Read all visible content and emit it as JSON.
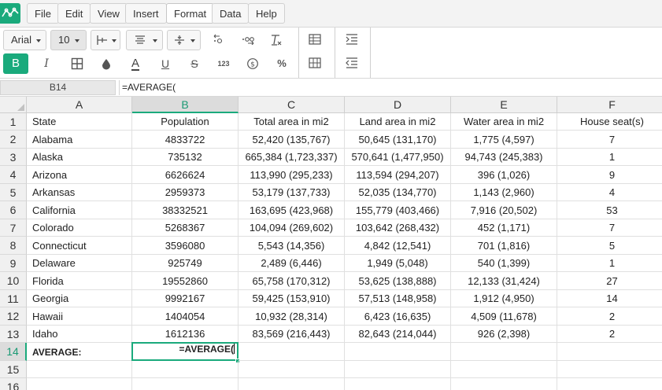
{
  "menu": {
    "items": [
      {
        "id": "file",
        "label": "File"
      },
      {
        "id": "edit",
        "label": "Edit"
      },
      {
        "id": "view",
        "label": "View"
      },
      {
        "id": "insert",
        "label": "Insert"
      },
      {
        "id": "format",
        "label": "Format"
      },
      {
        "id": "data",
        "label": "Data"
      },
      {
        "id": "help",
        "label": "Help"
      }
    ],
    "active": "Format"
  },
  "toolbar": {
    "font_family": "Arial",
    "font_size": "10",
    "number_format_label": "123",
    "accent_color": "#1aaa7c"
  },
  "formula_bar": {
    "cell_ref": "B14",
    "formula": "=AVERAGE("
  },
  "grid": {
    "columns": [
      "A",
      "B",
      "C",
      "D",
      "E",
      "F"
    ],
    "selected_column": "B",
    "selected_row": "14",
    "rows": [
      {
        "num": "1",
        "cells": [
          "State",
          "Population",
          "Total area in mi2",
          "Land area in mi2",
          "Water area in mi2",
          "House seat(s)"
        ]
      },
      {
        "num": "2",
        "cells": [
          "Alabama",
          "4833722",
          "52,420 (135,767)",
          "50,645 (131,170)",
          "1,775 (4,597)",
          "7"
        ]
      },
      {
        "num": "3",
        "cells": [
          "Alaska",
          "735132",
          "665,384 (1,723,337)",
          "570,641 (1,477,950)",
          "94,743 (245,383)",
          "1"
        ]
      },
      {
        "num": "4",
        "cells": [
          "Arizona",
          "6626624",
          "113,990 (295,233)",
          "113,594 (294,207)",
          "396 (1,026)",
          "9"
        ]
      },
      {
        "num": "5",
        "cells": [
          "Arkansas",
          "2959373",
          "53,179 (137,733)",
          "52,035 (134,770)",
          "1,143 (2,960)",
          "4"
        ]
      },
      {
        "num": "6",
        "cells": [
          "California",
          "38332521",
          "163,695 (423,968)",
          "155,779 (403,466)",
          "7,916 (20,502)",
          "53"
        ]
      },
      {
        "num": "7",
        "cells": [
          "Colorado",
          "5268367",
          "104,094 (269,602)",
          "103,642 (268,432)",
          "452 (1,171)",
          "7"
        ]
      },
      {
        "num": "8",
        "cells": [
          "Connecticut",
          "3596080",
          "5,543 (14,356)",
          "4,842 (12,541)",
          "701 (1,816)",
          "5"
        ]
      },
      {
        "num": "9",
        "cells": [
          "Delaware",
          "925749",
          "2,489 (6,446)",
          "1,949 (5,048)",
          "540 (1,399)",
          "1"
        ]
      },
      {
        "num": "10",
        "cells": [
          "Florida",
          "19552860",
          "65,758 (170,312)",
          "53,625 (138,888)",
          "12,133 (31,424)",
          "27"
        ]
      },
      {
        "num": "11",
        "cells": [
          "Georgia",
          "9992167",
          "59,425 (153,910)",
          "57,513 (148,958)",
          "1,912 (4,950)",
          "14"
        ]
      },
      {
        "num": "12",
        "cells": [
          "Hawaii",
          "1404054",
          "10,932 (28,314)",
          "6,423 (16,635)",
          "4,509 (11,678)",
          "2"
        ]
      },
      {
        "num": "13",
        "cells": [
          "Idaho",
          "1612136",
          "83,569 (216,443)",
          "82,643 (214,044)",
          "926 (2,398)",
          "2"
        ]
      },
      {
        "num": "14",
        "cells": [
          "AVERAGE:",
          "=AVERAGE(",
          "",
          "",
          "",
          ""
        ]
      },
      {
        "num": "15",
        "cells": [
          "",
          "",
          "",
          "",
          "",
          ""
        ]
      },
      {
        "num": "16",
        "cells": [
          "",
          "",
          "",
          "",
          "",
          ""
        ]
      }
    ]
  }
}
